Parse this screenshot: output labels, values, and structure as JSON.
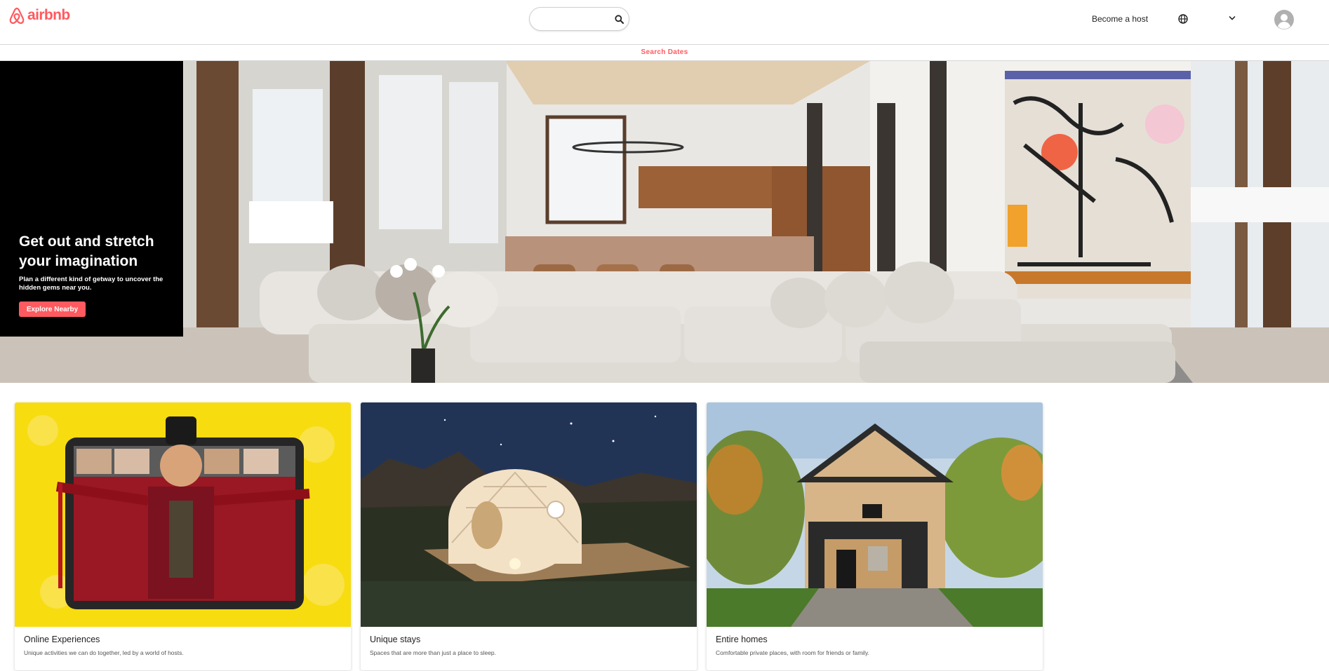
{
  "brand": {
    "name": "airbnb",
    "color": "#ff5a5f"
  },
  "header": {
    "search": {
      "value": "",
      "placeholder": "",
      "icon": "search-icon"
    },
    "become_host": "Become a host",
    "icons": [
      "globe-icon",
      "chevron-down-icon",
      "user-avatar-icon"
    ]
  },
  "search_dates": "Search Dates",
  "hero": {
    "title": "Get out and stretch your imagination",
    "subtitle": "Plan a different kind of getway to uncover the hidden gems near you.",
    "button": "Explore Nearby",
    "image": "living-room-photo"
  },
  "cards": [
    {
      "title": "Online Experiences",
      "description": "Unique activities we can do together, led by a world of hosts.",
      "image": "online-experience-photo"
    },
    {
      "title": "Unique stays",
      "description": "Spaces that are more than just a place to sleep.",
      "image": "dome-tent-photo"
    },
    {
      "title": "Entire homes",
      "description": "Comfortable private places, with room for friends or family.",
      "image": "cabin-house-photo"
    }
  ]
}
